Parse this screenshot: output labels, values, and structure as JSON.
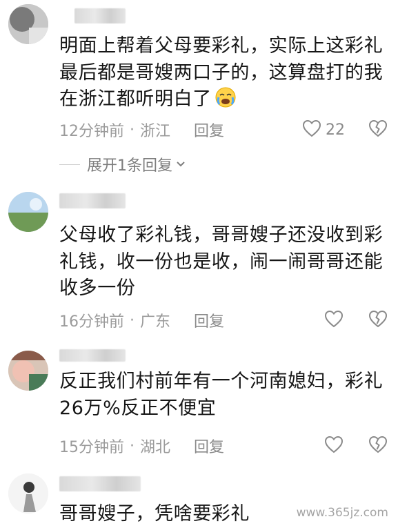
{
  "comments": [
    {
      "text": "明面上帮着父母要彩礼，实际上这彩礼最后都是哥嫂两口子的，这算盘打的我在浙江都听明白了",
      "time": "12分钟前",
      "location": "浙江",
      "reply_label": "回复",
      "like_count": "22",
      "expand_label": "展开1条回复"
    },
    {
      "text": "父母收了彩礼钱，哥哥嫂子还没收到彩礼钱，收一份也是收，闹一闹哥哥还能收多一份",
      "time": "16分钟前",
      "location": "广东",
      "reply_label": "回复",
      "like_count": ""
    },
    {
      "text": "反正我们村前年有一个河南媳妇，彩礼26万%反正不便宜",
      "time": "15分钟前",
      "location": "湖北",
      "reply_label": "回复",
      "like_count": ""
    },
    {
      "text": "哥哥嫂子，凭啥要彩礼"
    }
  ],
  "meta_separator": "·",
  "watermark": "www.365jz.com"
}
